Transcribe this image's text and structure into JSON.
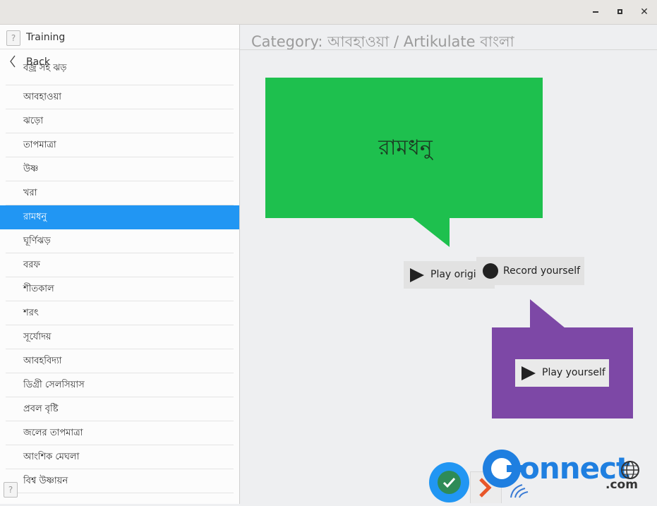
{
  "window": {
    "minimize_icon": "minimize-icon",
    "maximize_icon": "maximize-icon",
    "close_icon": "close-icon",
    "close_glyph": "✕"
  },
  "sidebar": {
    "header_title": "Training",
    "help_glyph": "?",
    "back_label": "Back",
    "items": [
      {
        "label": "বজ্র সহ ঝড়",
        "selected": false
      },
      {
        "label": "আবহাওয়া",
        "selected": false
      },
      {
        "label": "ঝড়ো",
        "selected": false
      },
      {
        "label": "তাপমাত্রা",
        "selected": false
      },
      {
        "label": "উষ্ণ",
        "selected": false
      },
      {
        "label": "খরা",
        "selected": false
      },
      {
        "label": "রামধনু",
        "selected": true
      },
      {
        "label": "ঘূর্ণিঝড়",
        "selected": false
      },
      {
        "label": "বরফ",
        "selected": false
      },
      {
        "label": "শীতকাল",
        "selected": false
      },
      {
        "label": "শরৎ",
        "selected": false
      },
      {
        "label": "সূর্যোদয়",
        "selected": false
      },
      {
        "label": "আবহবিদ্যা",
        "selected": false
      },
      {
        "label": "ডিগ্রী সেলসিয়াস",
        "selected": false
      },
      {
        "label": "প্রবল বৃষ্টি",
        "selected": false
      },
      {
        "label": "জলের তাপমাত্রা",
        "selected": false
      },
      {
        "label": "আংশিক মেঘলা",
        "selected": false
      },
      {
        "label": "বিশ্ব উষ্ণায়ন",
        "selected": false
      }
    ]
  },
  "main": {
    "category_title": "Category: আবহাওয়া / Artikulate বাংলা",
    "word": "রামধনু",
    "play_original_label": "Play original",
    "record_label": "Record yourself",
    "play_yourself_label": "Play yourself"
  },
  "colors": {
    "accent": "#2196f3",
    "original_bubble": "#1ec04e",
    "user_bubble": "#7d48a6"
  },
  "watermark": {
    "text": "onnect",
    "suffix": ".com"
  }
}
